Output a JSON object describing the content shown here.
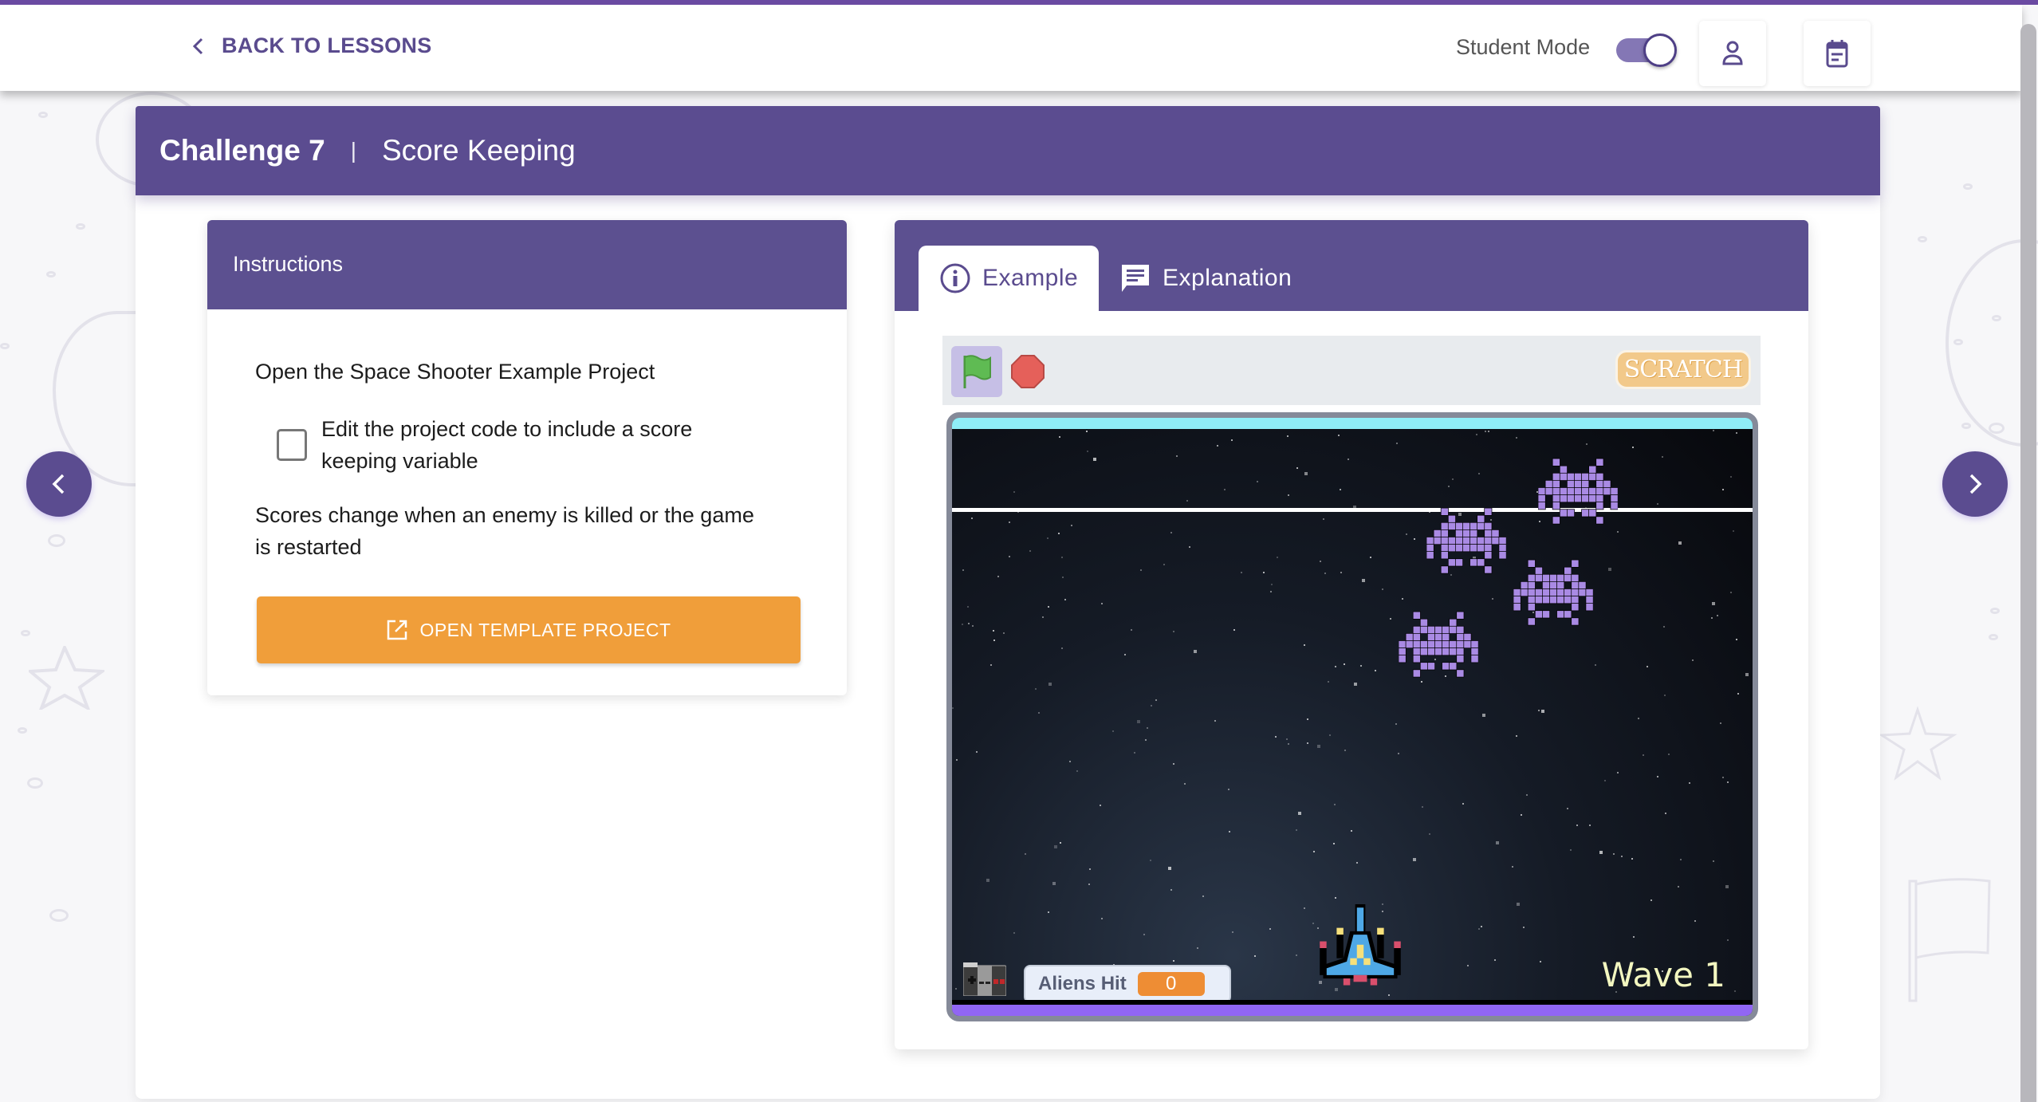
{
  "topbar": {
    "back_label": "BACK TO LESSONS",
    "student_mode_label": "Student Mode",
    "student_mode_on": true,
    "icons": [
      "person-icon",
      "calendar-icon"
    ]
  },
  "challenge": {
    "number_label": "Challenge 7",
    "separator": "|",
    "name": "Score Keeping"
  },
  "instructions": {
    "title": "Instructions",
    "step1": "Open the Space Shooter Example Project",
    "checkbox_line1": "Edit the project code to include a score",
    "checkbox_line2": "keeping variable",
    "checkbox_checked": false,
    "note_line1": "Scores change when an enemy is killed or the game",
    "note_line2": "is restarted",
    "open_button_label": "OPEN TEMPLATE PROJECT"
  },
  "tabs": [
    {
      "label": "Example",
      "icon": "info-icon",
      "active": true
    },
    {
      "label": "Explanation",
      "icon": "comment-icon",
      "active": false
    }
  ],
  "scratch": {
    "logo_text": "SCRATCH",
    "monitor_label": "Aliens Hit",
    "monitor_value": "0",
    "wave_text": "Wave 1"
  },
  "colors": {
    "brand_purple": "#5b4c90",
    "accent_orange": "#f09e3a",
    "alien_purple": "#a98ae4",
    "ship_blue": "#4ea8e6"
  }
}
